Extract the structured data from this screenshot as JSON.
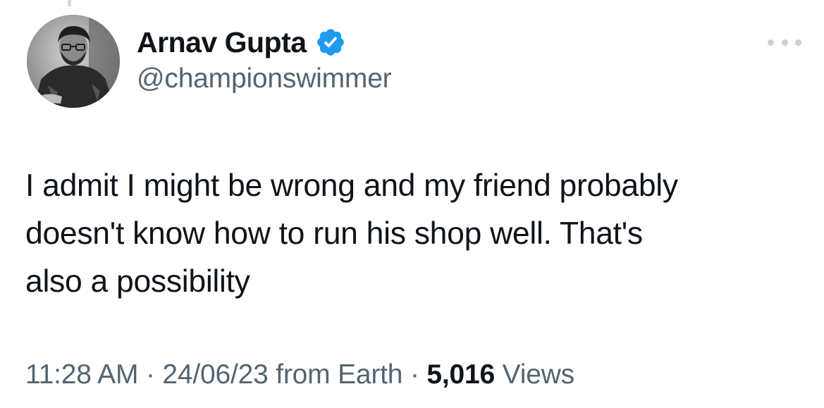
{
  "tweet": {
    "author": {
      "display_name": "Arnav Gupta",
      "handle": "@championswimmer",
      "verified": true,
      "verified_color": "#1d9bf0"
    },
    "text_lines": [
      "I admit I might be wrong and my friend probably",
      "doesn't know how to run his shop well. That's",
      "also a possibility"
    ],
    "meta": {
      "time": "11:28 AM",
      "separator": "·",
      "date": "24/06/23",
      "source": "from Earth",
      "views_count": "5,016",
      "views_label": "Views"
    }
  },
  "icons": {
    "more": "more-horizontal-icon",
    "verified": "verified-badge-icon"
  },
  "colors": {
    "primary_text": "#0f1419",
    "secondary_text": "#536471",
    "accent": "#1d9bf0"
  }
}
